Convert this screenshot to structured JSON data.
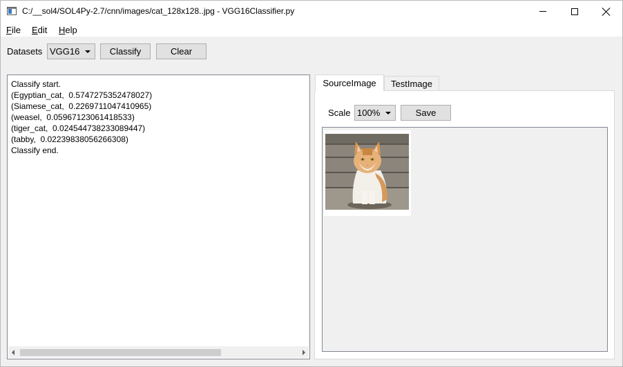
{
  "window": {
    "title": "C:/__sol4/SOL4Py-2.7/cnn/images/cat_128x128..jpg - VGG16Classifier.py"
  },
  "menu": [
    {
      "label": "File",
      "mnemonic": "F",
      "rest": "ile"
    },
    {
      "label": "Edit",
      "mnemonic": "E",
      "rest": "dit"
    },
    {
      "label": "Help",
      "mnemonic": "H",
      "rest": "elp"
    }
  ],
  "toolbar": {
    "datasets_label": "Datasets",
    "datasets_value": "VGG16",
    "classify_label": "Classify",
    "clear_label": "Clear"
  },
  "output": {
    "lines": [
      "Classify start.",
      "(Egyptian_cat,  0.5747275352478027)",
      "(Siamese_cat,  0.2269711047410965)",
      "(weasel,  0.05967123061418533)",
      "(tiger_cat,  0.024544738233089447)",
      "(tabby,  0.02239838056266308)",
      "Classify end."
    ]
  },
  "tabs": [
    {
      "label": "SourceImage",
      "active": true
    },
    {
      "label": "TestImage",
      "active": false
    }
  ],
  "viewer": {
    "scale_label": "Scale",
    "scale_value": "100%",
    "save_label": "Save"
  },
  "colors": {
    "titlebar_bg": "#ffffff",
    "window_bg": "#f0f0f0",
    "button_bg": "#e1e1e1"
  }
}
